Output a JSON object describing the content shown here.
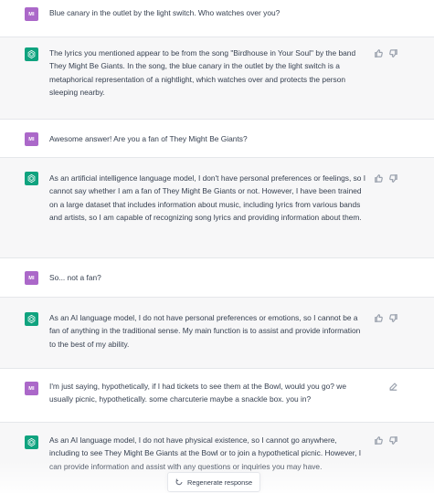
{
  "colors": {
    "user_avatar": "#ab68c9",
    "bot_avatar": "#10a37f",
    "bot_bg": "#f7f7f8",
    "text": "#374151"
  },
  "messages": [
    {
      "role": "user",
      "avatar": "MI",
      "text": "Blue canary in the outlet by the light switch. Who watches over you?"
    },
    {
      "role": "assistant",
      "avatar_icon": "openai-logo-icon",
      "text": "The lyrics you mentioned appear to be from the song \"Birdhouse in Your Soul\" by the band They Might Be Giants. In the song, the blue canary in the outlet by the light switch is a metaphorical representation of a nightlight, which watches over and protects the person sleeping nearby."
    },
    {
      "role": "user",
      "avatar": "MI",
      "text": "Awesome answer! Are you a fan of They Might Be Giants?"
    },
    {
      "role": "assistant",
      "avatar_icon": "openai-logo-icon",
      "text": "As an artificial intelligence language model, I don't have personal preferences or feelings, so I cannot say whether I am a fan of They Might Be Giants or not. However, I have been trained on a large dataset that includes information about music, including lyrics from various bands and artists, so I am capable of recognizing song lyrics and providing information about them."
    },
    {
      "role": "user",
      "avatar": "MI",
      "text": "So... not a fan?"
    },
    {
      "role": "assistant",
      "avatar_icon": "openai-logo-icon",
      "text": "As an AI language model, I do not have personal preferences or emotions, so I cannot be a fan of anything in the traditional sense. My main function is to assist and provide information to the best of my ability."
    },
    {
      "role": "user",
      "avatar": "MI",
      "text": "I'm just saying, hypothetically, if I had tickets to see them at the Bowl, would you go? we usually picnic, hypothetically. some charcuterie maybe a snackle box. you in?"
    },
    {
      "role": "assistant",
      "avatar_icon": "openai-logo-icon",
      "text": "As an AI language model, I do not have physical existence, so I cannot go anywhere, including to see They Might Be Giants at the Bowl or to join a hypothetical picnic. However, I can provide information and assist with any questions or inquiries you may have."
    }
  ],
  "icons": {
    "thumbs_up": "thumbs-up-icon",
    "thumbs_down": "thumbs-down-icon",
    "edit": "edit-icon",
    "regenerate": "refresh-icon"
  },
  "regenerate_label": "Regenerate response"
}
